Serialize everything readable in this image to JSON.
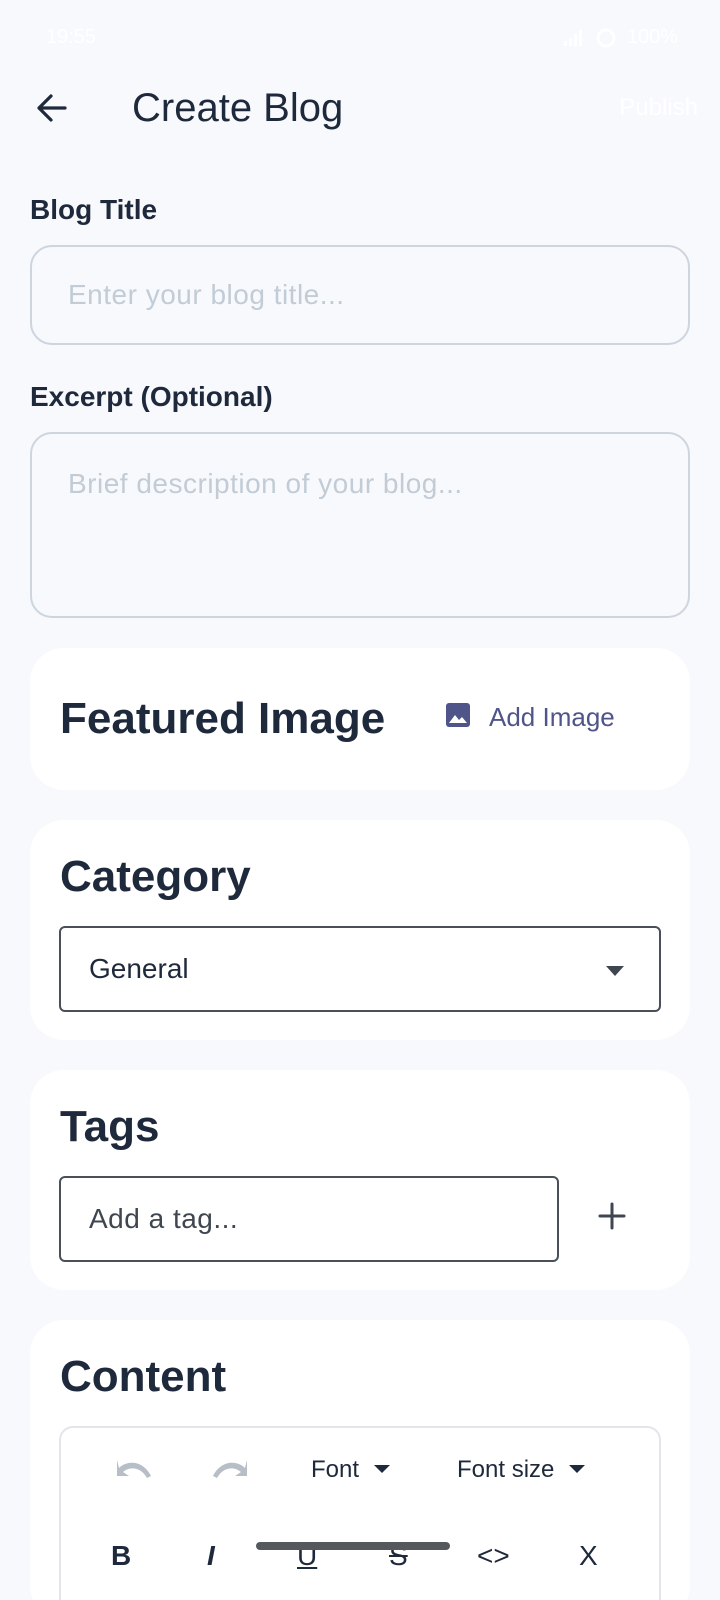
{
  "status_bar": {
    "time": "19:55",
    "battery": "100%",
    "icons": [
      "wifi-icon",
      "phone-icon",
      "signal-icon",
      "battery-icon"
    ]
  },
  "app_bar": {
    "title": "Create Blog",
    "publish_label": "Publish",
    "back_icon": "arrow-left-icon"
  },
  "blog_title": {
    "label": "Blog Title",
    "value": "",
    "placeholder": "Enter your blog title..."
  },
  "excerpt": {
    "label": "Excerpt (Optional)",
    "value": "",
    "placeholder": "Brief description of your blog..."
  },
  "featured_image": {
    "title": "Featured Image",
    "add_label": "Add Image",
    "icon": "image-icon"
  },
  "category": {
    "title": "Category",
    "selected": "General"
  },
  "tags": {
    "title": "Tags",
    "value": "",
    "placeholder": "Add a tag...",
    "add_icon": "plus-icon"
  },
  "content": {
    "title": "Content",
    "toolbar": {
      "font_label": "Font",
      "font_size_label": "Font size",
      "format_buttons": [
        "B",
        "I",
        "U",
        "S",
        "<>",
        "X"
      ]
    }
  },
  "colors": {
    "background": "#f7f9fc",
    "card": "#ffffff",
    "accent": "#4f5589",
    "text": "#1e293b",
    "placeholder": "#c2ccd6"
  }
}
